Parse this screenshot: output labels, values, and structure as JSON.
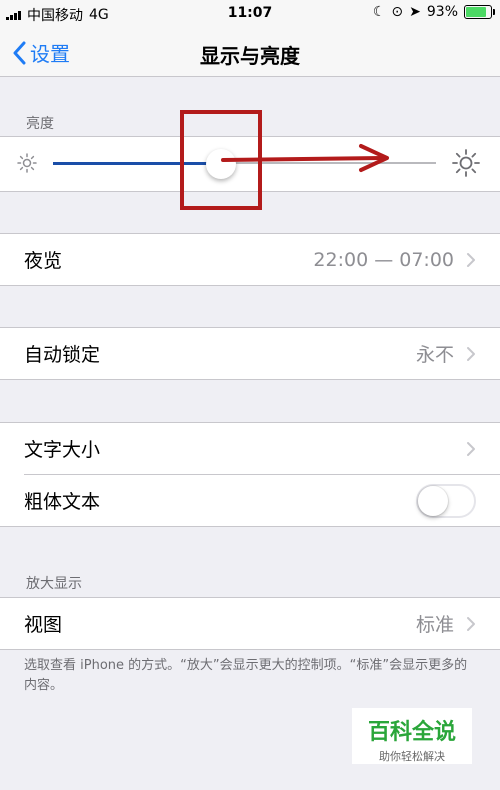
{
  "status_bar": {
    "carrier": "中国移动",
    "network": "4G",
    "time": "11:07",
    "battery_percent": "93%",
    "battery_level": 0.93
  },
  "nav": {
    "back_label": "设置",
    "title": "显示与亮度"
  },
  "brightness": {
    "section_label": "亮度",
    "level": 0.45
  },
  "night_shift": {
    "label": "夜览",
    "value": "22:00 — 07:00"
  },
  "auto_lock": {
    "label": "自动锁定",
    "value": "永不"
  },
  "text": {
    "text_size_label": "文字大小",
    "bold_text_label": "粗体文本",
    "bold_text_on": false
  },
  "zoom": {
    "section_label": "放大显示",
    "view_label": "视图",
    "view_value": "标准",
    "footer": "选取查看 iPhone 的方式。“放大”会显示更大的控制项。“标准”会显示更多的内容。"
  },
  "watermark": {
    "brand": "百科全说",
    "slogan": "助你轻松解决"
  },
  "colors": {
    "ios_blue": "#1f7cf5",
    "toggle_on": "#4cd964",
    "annotation_red": "#b31b1b"
  }
}
